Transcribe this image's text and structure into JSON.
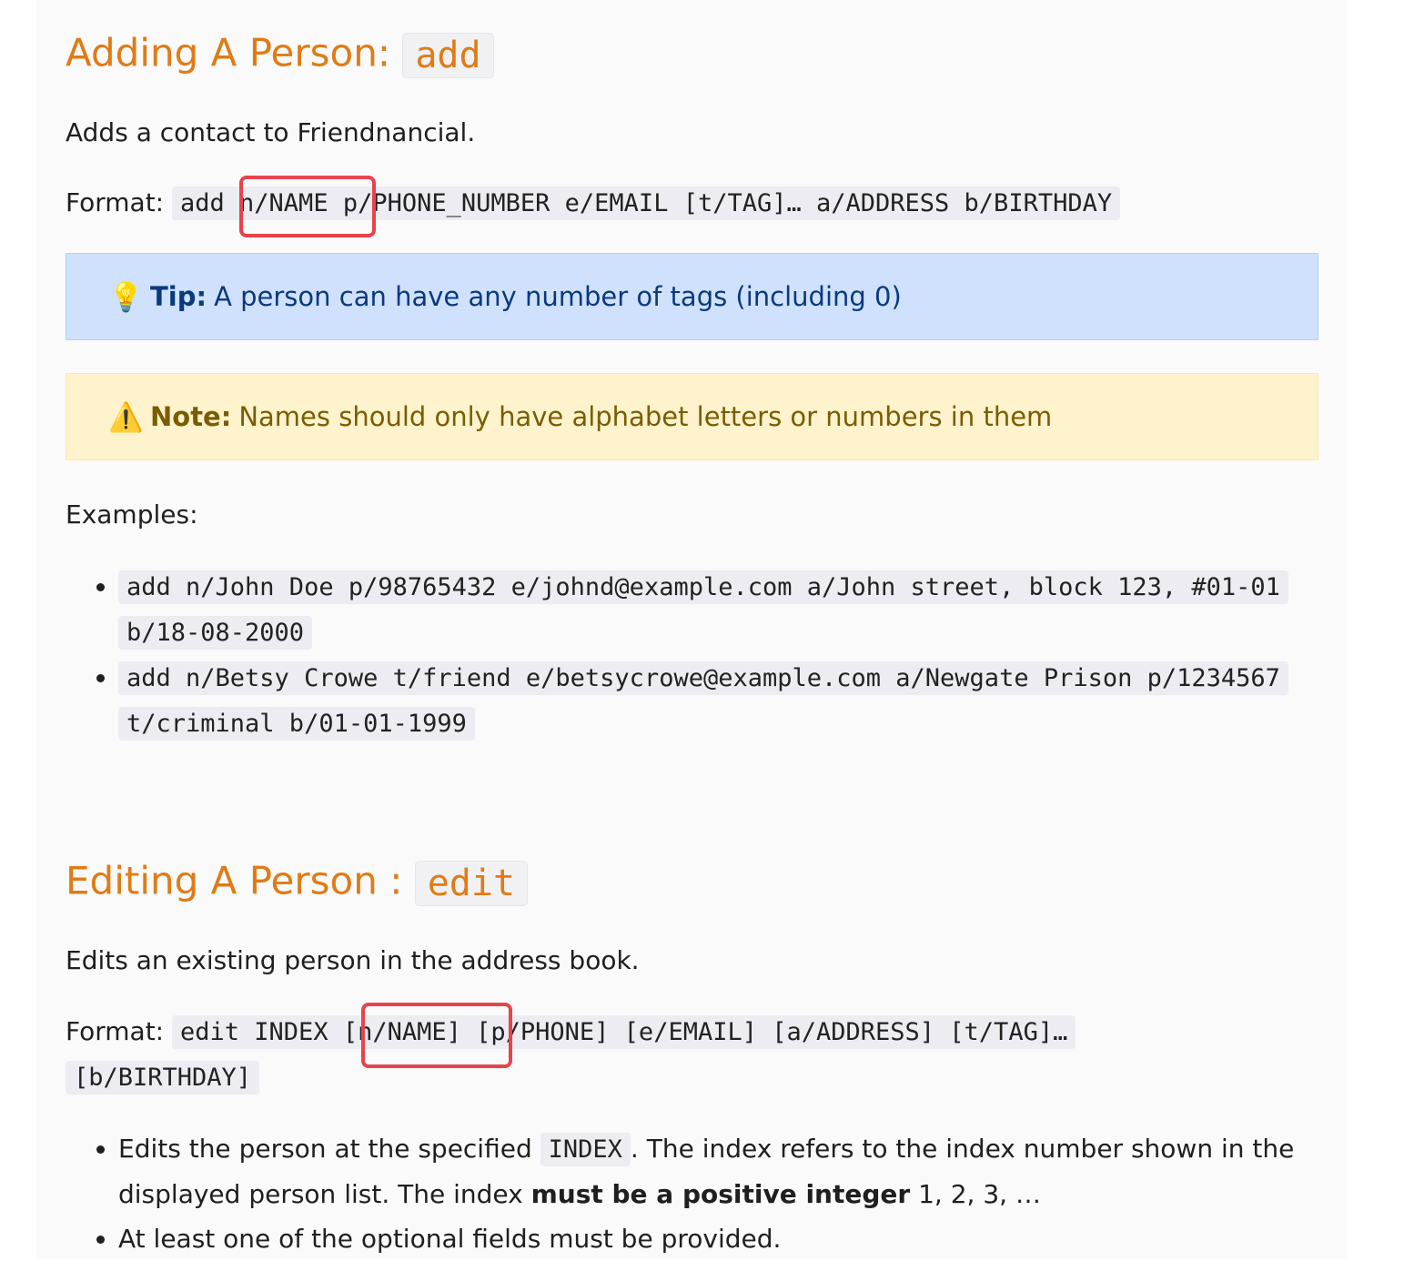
{
  "section_add": {
    "heading": "Adding A Person: ",
    "heading_code": "add",
    "description": "Adds a contact to Friendnancial.",
    "format_label": "Format: ",
    "format_code": "add n/NAME p/PHONE_NUMBER e/EMAIL [t/TAG]… a/ADDRESS b/BIRTHDAY",
    "tip_icon": "lightbulb-icon",
    "tip_label": "Tip:",
    "tip_text": "A person can have any number of tags (including 0)",
    "note_icon": "warning-icon",
    "note_label": "Note:",
    "note_text": "Names should only have alphabet letters or numbers in them",
    "examples_label": "Examples:",
    "examples": [
      "add n/John Doe p/98765432 e/johnd@example.com a/John street, block 123, #01-01 b/18-08-2000",
      "add n/Betsy Crowe t/friend e/betsycrowe@example.com a/Newgate Prison p/1234567 t/criminal b/01-01-1999"
    ]
  },
  "section_edit": {
    "heading": "Editing A Person : ",
    "heading_code": "edit",
    "description": "Edits an existing person in the address book.",
    "format_label": "Format: ",
    "format_code": "edit INDEX [n/NAME] [p/PHONE] [e/EMAIL] [a/ADDRESS] [t/TAG]… [b/BIRTHDAY]",
    "bullet1_pre": "Edits the person at the specified ",
    "bullet1_code": "INDEX",
    "bullet1_mid": ". The index refers to the index number shown in the displayed person list. The index ",
    "bullet1_bold": "must be a positive integer",
    "bullet1_post": " 1, 2, 3, …",
    "bullet2": "At least one of the optional fields must be provided."
  },
  "colors": {
    "heading": "#e07b16",
    "highlight_box": "#e8434c",
    "tip_bg": "#cfe1fd",
    "note_bg": "#fef3cc"
  }
}
